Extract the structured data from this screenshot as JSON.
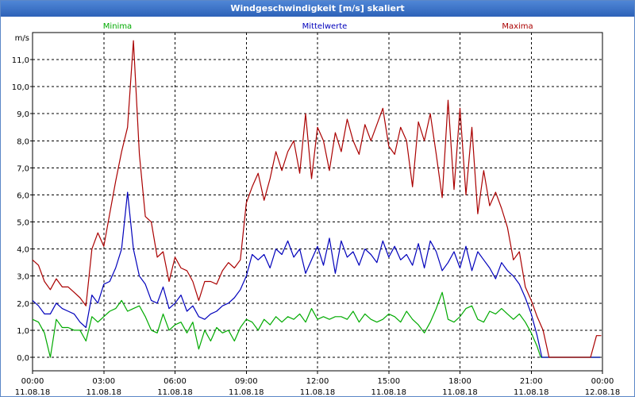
{
  "window": {
    "title": "Windgeschwindigkeit [m/s] skaliert"
  },
  "chart_data": {
    "type": "line",
    "title": "Windgeschwindigkeit [m/s] skaliert",
    "ylabel": "m/s",
    "ylim": [
      -0.5,
      12.0
    ],
    "xlim": [
      0,
      24
    ],
    "grid": true,
    "y_ticks": [
      "0,0",
      "1,0",
      "2,0",
      "3,0",
      "4,0",
      "5,0",
      "6,0",
      "7,0",
      "8,0",
      "9,0",
      "10,0",
      "11,0"
    ],
    "y_tick_values": [
      0,
      1,
      2,
      3,
      4,
      5,
      6,
      7,
      8,
      9,
      10,
      11
    ],
    "x_ticks": [
      {
        "time": "00:00",
        "date": "11.08.18",
        "hour": 0
      },
      {
        "time": "03:00",
        "date": "11.08.18",
        "hour": 3
      },
      {
        "time": "06:00",
        "date": "11.08.18",
        "hour": 6
      },
      {
        "time": "09:00",
        "date": "11.08.18",
        "hour": 9
      },
      {
        "time": "12:00",
        "date": "11.08.18",
        "hour": 12
      },
      {
        "time": "15:00",
        "date": "11.08.18",
        "hour": 15
      },
      {
        "time": "18:00",
        "date": "11.08.18",
        "hour": 18
      },
      {
        "time": "21:00",
        "date": "11.08.18",
        "hour": 21
      },
      {
        "time": "00:00",
        "date": "12.08.18",
        "hour": 24
      }
    ],
    "series": [
      {
        "name": "Minima",
        "color": "#00aa00",
        "points": [
          [
            0.0,
            1.4
          ],
          [
            0.25,
            1.3
          ],
          [
            0.5,
            0.9
          ],
          [
            0.75,
            0.0
          ],
          [
            1.0,
            1.4
          ],
          [
            1.25,
            1.1
          ],
          [
            1.5,
            1.1
          ],
          [
            1.75,
            1.0
          ],
          [
            2.0,
            1.0
          ],
          [
            2.25,
            0.6
          ],
          [
            2.5,
            1.5
          ],
          [
            2.75,
            1.3
          ],
          [
            3.0,
            1.5
          ],
          [
            3.25,
            1.7
          ],
          [
            3.5,
            1.8
          ],
          [
            3.75,
            2.1
          ],
          [
            4.0,
            1.7
          ],
          [
            4.25,
            1.8
          ],
          [
            4.5,
            1.9
          ],
          [
            4.75,
            1.5
          ],
          [
            5.0,
            1.0
          ],
          [
            5.25,
            0.9
          ],
          [
            5.5,
            1.6
          ],
          [
            5.75,
            1.0
          ],
          [
            6.0,
            1.2
          ],
          [
            6.25,
            1.3
          ],
          [
            6.5,
            0.9
          ],
          [
            6.75,
            1.3
          ],
          [
            7.0,
            0.3
          ],
          [
            7.25,
            1.0
          ],
          [
            7.5,
            0.6
          ],
          [
            7.75,
            1.1
          ],
          [
            8.0,
            0.9
          ],
          [
            8.25,
            1.0
          ],
          [
            8.5,
            0.6
          ],
          [
            8.75,
            1.1
          ],
          [
            9.0,
            1.4
          ],
          [
            9.25,
            1.3
          ],
          [
            9.5,
            1.0
          ],
          [
            9.75,
            1.4
          ],
          [
            10.0,
            1.2
          ],
          [
            10.25,
            1.5
          ],
          [
            10.5,
            1.3
          ],
          [
            10.75,
            1.5
          ],
          [
            11.0,
            1.4
          ],
          [
            11.25,
            1.6
          ],
          [
            11.5,
            1.3
          ],
          [
            11.75,
            1.8
          ],
          [
            12.0,
            1.4
          ],
          [
            12.25,
            1.5
          ],
          [
            12.5,
            1.4
          ],
          [
            12.75,
            1.5
          ],
          [
            13.0,
            1.5
          ],
          [
            13.25,
            1.4
          ],
          [
            13.5,
            1.7
          ],
          [
            13.75,
            1.3
          ],
          [
            14.0,
            1.6
          ],
          [
            14.25,
            1.4
          ],
          [
            14.5,
            1.3
          ],
          [
            14.75,
            1.4
          ],
          [
            15.0,
            1.6
          ],
          [
            15.25,
            1.5
          ],
          [
            15.5,
            1.3
          ],
          [
            15.75,
            1.7
          ],
          [
            16.0,
            1.4
          ],
          [
            16.25,
            1.2
          ],
          [
            16.5,
            0.9
          ],
          [
            16.75,
            1.3
          ],
          [
            17.0,
            1.8
          ],
          [
            17.25,
            2.4
          ],
          [
            17.5,
            1.4
          ],
          [
            17.75,
            1.3
          ],
          [
            18.0,
            1.5
          ],
          [
            18.25,
            1.8
          ],
          [
            18.5,
            1.9
          ],
          [
            18.75,
            1.4
          ],
          [
            19.0,
            1.3
          ],
          [
            19.25,
            1.7
          ],
          [
            19.5,
            1.6
          ],
          [
            19.75,
            1.8
          ],
          [
            20.0,
            1.6
          ],
          [
            20.25,
            1.4
          ],
          [
            20.5,
            1.6
          ],
          [
            20.75,
            1.3
          ],
          [
            21.0,
            0.9
          ],
          [
            21.25,
            0.4
          ],
          [
            21.4,
            0.0
          ],
          [
            21.75,
            0.0
          ],
          [
            22.0,
            0.0
          ],
          [
            22.5,
            0.0
          ],
          [
            23.0,
            0.0
          ],
          [
            23.5,
            0.0
          ],
          [
            23.9,
            0.0
          ]
        ]
      },
      {
        "name": "Mittelwerte",
        "color": "#0000bb",
        "points": [
          [
            0.0,
            2.1
          ],
          [
            0.25,
            1.9
          ],
          [
            0.5,
            1.6
          ],
          [
            0.75,
            1.6
          ],
          [
            1.0,
            2.0
          ],
          [
            1.25,
            1.8
          ],
          [
            1.5,
            1.7
          ],
          [
            1.75,
            1.6
          ],
          [
            2.0,
            1.3
          ],
          [
            2.25,
            1.1
          ],
          [
            2.5,
            2.3
          ],
          [
            2.75,
            2.0
          ],
          [
            3.0,
            2.7
          ],
          [
            3.25,
            2.8
          ],
          [
            3.5,
            3.3
          ],
          [
            3.75,
            4.0
          ],
          [
            4.0,
            6.1
          ],
          [
            4.25,
            4.0
          ],
          [
            4.5,
            3.0
          ],
          [
            4.75,
            2.7
          ],
          [
            5.0,
            2.1
          ],
          [
            5.25,
            2.0
          ],
          [
            5.5,
            2.6
          ],
          [
            5.75,
            1.8
          ],
          [
            6.0,
            2.0
          ],
          [
            6.25,
            2.3
          ],
          [
            6.5,
            1.7
          ],
          [
            6.75,
            1.9
          ],
          [
            7.0,
            1.5
          ],
          [
            7.25,
            1.4
          ],
          [
            7.5,
            1.6
          ],
          [
            7.75,
            1.7
          ],
          [
            8.0,
            1.9
          ],
          [
            8.25,
            2.0
          ],
          [
            8.5,
            2.2
          ],
          [
            8.75,
            2.5
          ],
          [
            9.0,
            3.0
          ],
          [
            9.25,
            3.8
          ],
          [
            9.5,
            3.6
          ],
          [
            9.75,
            3.8
          ],
          [
            10.0,
            3.3
          ],
          [
            10.25,
            4.0
          ],
          [
            10.5,
            3.8
          ],
          [
            10.75,
            4.3
          ],
          [
            11.0,
            3.7
          ],
          [
            11.25,
            4.0
          ],
          [
            11.5,
            3.1
          ],
          [
            11.75,
            3.6
          ],
          [
            12.0,
            4.1
          ],
          [
            12.25,
            3.4
          ],
          [
            12.5,
            4.4
          ],
          [
            12.75,
            3.1
          ],
          [
            13.0,
            4.3
          ],
          [
            13.25,
            3.7
          ],
          [
            13.5,
            3.9
          ],
          [
            13.75,
            3.4
          ],
          [
            14.0,
            4.0
          ],
          [
            14.25,
            3.8
          ],
          [
            14.5,
            3.5
          ],
          [
            14.75,
            4.3
          ],
          [
            15.0,
            3.7
          ],
          [
            15.25,
            4.1
          ],
          [
            15.5,
            3.6
          ],
          [
            15.75,
            3.8
          ],
          [
            16.0,
            3.4
          ],
          [
            16.25,
            4.2
          ],
          [
            16.5,
            3.3
          ],
          [
            16.75,
            4.3
          ],
          [
            17.0,
            3.9
          ],
          [
            17.25,
            3.2
          ],
          [
            17.5,
            3.5
          ],
          [
            17.75,
            3.9
          ],
          [
            18.0,
            3.3
          ],
          [
            18.25,
            4.1
          ],
          [
            18.5,
            3.2
          ],
          [
            18.75,
            3.9
          ],
          [
            19.0,
            3.6
          ],
          [
            19.25,
            3.3
          ],
          [
            19.5,
            2.9
          ],
          [
            19.75,
            3.5
          ],
          [
            20.0,
            3.2
          ],
          [
            20.25,
            3.0
          ],
          [
            20.5,
            2.7
          ],
          [
            20.75,
            2.2
          ],
          [
            21.0,
            1.6
          ],
          [
            21.25,
            0.8
          ],
          [
            21.45,
            0.0
          ],
          [
            21.75,
            0.0
          ],
          [
            22.0,
            0.0
          ],
          [
            22.5,
            0.0
          ],
          [
            23.0,
            0.0
          ],
          [
            23.5,
            0.0
          ],
          [
            23.9,
            0.0
          ]
        ]
      },
      {
        "name": "Maxima",
        "color": "#aa0000",
        "points": [
          [
            0.0,
            3.6
          ],
          [
            0.25,
            3.4
          ],
          [
            0.5,
            2.8
          ],
          [
            0.75,
            2.5
          ],
          [
            1.0,
            2.9
          ],
          [
            1.25,
            2.6
          ],
          [
            1.5,
            2.6
          ],
          [
            1.75,
            2.4
          ],
          [
            2.0,
            2.2
          ],
          [
            2.25,
            1.9
          ],
          [
            2.5,
            4.0
          ],
          [
            2.75,
            4.6
          ],
          [
            3.0,
            4.1
          ],
          [
            3.25,
            5.3
          ],
          [
            3.5,
            6.5
          ],
          [
            3.75,
            7.6
          ],
          [
            4.0,
            8.5
          ],
          [
            4.25,
            11.7
          ],
          [
            4.5,
            7.5
          ],
          [
            4.75,
            5.2
          ],
          [
            5.0,
            5.0
          ],
          [
            5.25,
            3.7
          ],
          [
            5.5,
            3.9
          ],
          [
            5.75,
            2.8
          ],
          [
            6.0,
            3.7
          ],
          [
            6.25,
            3.3
          ],
          [
            6.5,
            3.2
          ],
          [
            6.75,
            2.8
          ],
          [
            7.0,
            2.1
          ],
          [
            7.25,
            2.8
          ],
          [
            7.5,
            2.8
          ],
          [
            7.75,
            2.7
          ],
          [
            8.0,
            3.2
          ],
          [
            8.25,
            3.5
          ],
          [
            8.5,
            3.3
          ],
          [
            8.75,
            3.6
          ],
          [
            9.0,
            5.7
          ],
          [
            9.25,
            6.3
          ],
          [
            9.5,
            6.8
          ],
          [
            9.75,
            5.8
          ],
          [
            10.0,
            6.6
          ],
          [
            10.25,
            7.6
          ],
          [
            10.5,
            6.9
          ],
          [
            10.75,
            7.6
          ],
          [
            11.0,
            8.0
          ],
          [
            11.25,
            6.8
          ],
          [
            11.5,
            9.0
          ],
          [
            11.75,
            6.6
          ],
          [
            12.0,
            8.5
          ],
          [
            12.25,
            8.0
          ],
          [
            12.5,
            6.9
          ],
          [
            12.75,
            8.3
          ],
          [
            13.0,
            7.6
          ],
          [
            13.25,
            8.8
          ],
          [
            13.5,
            8.0
          ],
          [
            13.75,
            7.5
          ],
          [
            14.0,
            8.6
          ],
          [
            14.25,
            8.0
          ],
          [
            14.5,
            8.6
          ],
          [
            14.75,
            9.2
          ],
          [
            15.0,
            7.8
          ],
          [
            15.25,
            7.5
          ],
          [
            15.5,
            8.5
          ],
          [
            15.75,
            8.0
          ],
          [
            16.0,
            6.3
          ],
          [
            16.25,
            8.7
          ],
          [
            16.5,
            8.0
          ],
          [
            16.75,
            9.0
          ],
          [
            17.0,
            7.5
          ],
          [
            17.25,
            5.9
          ],
          [
            17.5,
            9.5
          ],
          [
            17.75,
            6.2
          ],
          [
            18.0,
            9.2
          ],
          [
            18.25,
            6.0
          ],
          [
            18.5,
            8.5
          ],
          [
            18.75,
            5.3
          ],
          [
            19.0,
            6.9
          ],
          [
            19.25,
            5.6
          ],
          [
            19.5,
            6.1
          ],
          [
            19.75,
            5.5
          ],
          [
            20.0,
            4.8
          ],
          [
            20.25,
            3.6
          ],
          [
            20.5,
            3.9
          ],
          [
            20.75,
            2.6
          ],
          [
            21.0,
            2.1
          ],
          [
            21.25,
            1.5
          ],
          [
            21.5,
            1.0
          ],
          [
            21.75,
            0.0
          ],
          [
            22.0,
            0.0
          ],
          [
            22.5,
            0.0
          ],
          [
            23.0,
            0.0
          ],
          [
            23.5,
            0.0
          ],
          [
            23.75,
            0.8
          ],
          [
            23.95,
            0.8
          ]
        ]
      }
    ]
  }
}
